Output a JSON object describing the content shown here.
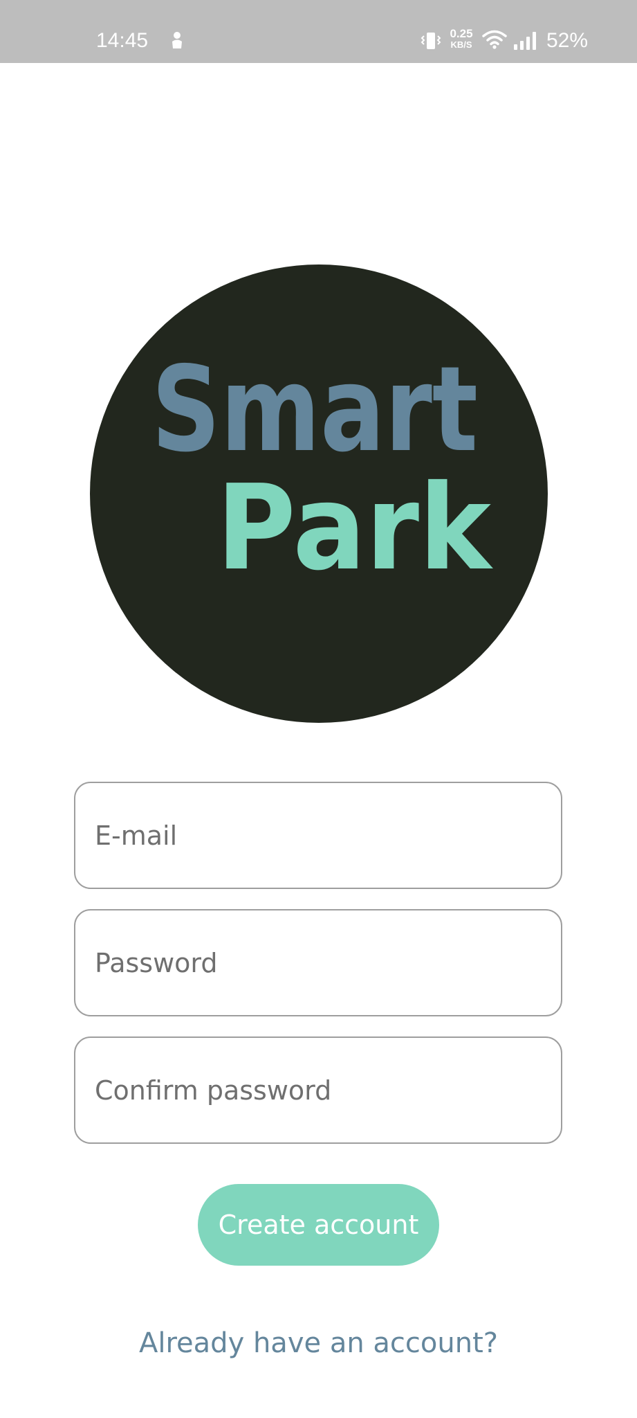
{
  "status_bar": {
    "time": "14:45",
    "speed_value": "0.25",
    "speed_unit": "KB/S",
    "battery": "52%",
    "icons": [
      "notification-icon",
      "vibrate-icon",
      "wifi-icon",
      "signal-icon"
    ]
  },
  "logo": {
    "line1": "Smart",
    "line2": "Park",
    "colors": {
      "circle": "#22271e",
      "line1": "#64869c",
      "line2": "#80d6bd"
    }
  },
  "form": {
    "email": {
      "placeholder": "E-mail",
      "value": ""
    },
    "password": {
      "placeholder": "Password",
      "value": ""
    },
    "confirm_password": {
      "placeholder": "Confirm password",
      "value": ""
    },
    "create_button_label": "Create account",
    "login_link_label": "Already have an account?"
  },
  "colors": {
    "accent": "#80d6bd",
    "link": "#64869c",
    "status_bar": "#bdbdbd",
    "field_border": "#9e9e9e"
  }
}
